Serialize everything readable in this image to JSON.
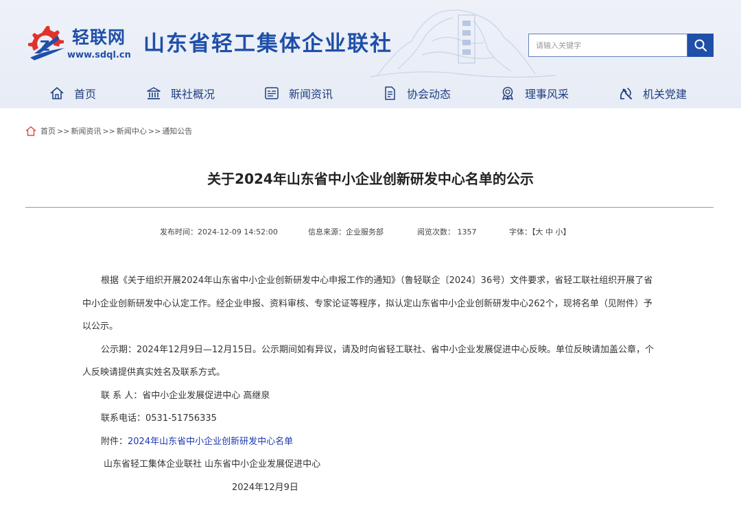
{
  "header": {
    "brand_name": "轻联网",
    "brand_url": "www.sdql.cn",
    "org_title": "山东省轻工集体企业联社",
    "search": {
      "placeholder": "请输入关键字"
    }
  },
  "nav": {
    "items": [
      {
        "label": "首页",
        "icon": "home-icon"
      },
      {
        "label": "联社概况",
        "icon": "bank-icon"
      },
      {
        "label": "新闻资讯",
        "icon": "news-icon"
      },
      {
        "label": "协会动态",
        "icon": "document-icon"
      },
      {
        "label": "理事风采",
        "icon": "medal-icon"
      },
      {
        "label": "机关党建",
        "icon": "party-emblem-icon"
      }
    ]
  },
  "breadcrumb": {
    "items": [
      "首页",
      "新闻资讯",
      "新闻中心",
      "通知公告"
    ],
    "separator": ">>"
  },
  "article": {
    "title": "关于2024年山东省中小企业创新研发中心名单的公示",
    "meta": {
      "publish_time": "发布时间：2024-12-09 14:52:00",
      "source": "信息来源：企业服务部",
      "views": "阅览次数：  1357",
      "font_size": "字体：【大 中 小】"
    },
    "paragraphs": {
      "p1": "根据《关于组织开展2024年山东省中小企业创新研发中心申报工作的通知》（鲁轻联企〔2024〕36号）文件要求，省轻工联社组织开展了省中小企业创新研发中心认定工作。经企业申报、资料审核、专家论证等程序，拟认定山东省中小企业创新研发中心262个，现将名单（见附件）予以公示。",
      "p2": "公示期：2024年12月9日—12月15日。公示期间如有异议，请及时向省轻工联社、省中小企业发展促进中心反映。单位反映请加盖公章，个人反映请提供真实姓名及联系方式。",
      "contact": "联 系 人：省中小企业发展促进中心 高继泉",
      "phone": "联系电话：0531-51756335",
      "attachment_label": "附件：",
      "attachment_link": "2024年山东省中小企业创新研发中心名单",
      "signature": "山东省轻工集体企业联社  山东省中小企业发展促进中心",
      "date": "2024年12月9日"
    }
  },
  "colors": {
    "brand_blue": "#1f4fa8",
    "header_bg": "#e9edf7",
    "link_blue": "#1d39b0",
    "logo_red": "#e0322b"
  }
}
